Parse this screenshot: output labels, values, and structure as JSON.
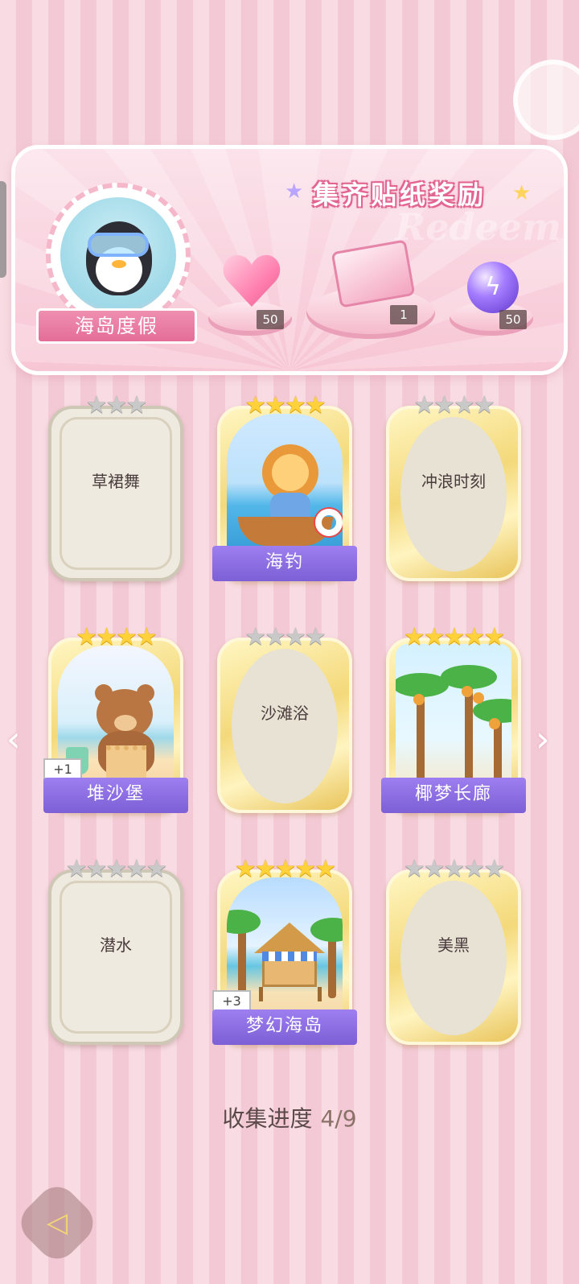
{
  "banner": {
    "title": "集齐贴纸奖励",
    "watermark": "Redeem",
    "album_name": "海岛度假",
    "rewards": [
      {
        "icon": "heart-gem-icon",
        "count": "50"
      },
      {
        "icon": "gift-box-icon",
        "count": "1"
      },
      {
        "icon": "lightning-orb-icon",
        "count": "50"
      }
    ]
  },
  "cards": [
    {
      "name": "草裙舞",
      "stars": 3,
      "star_color": "silver",
      "frame": "silver",
      "collected": false
    },
    {
      "name": "海钓",
      "stars": 4,
      "star_color": "gold",
      "frame": "gold",
      "collected": true,
      "art": "lion-fishing"
    },
    {
      "name": "冲浪时刻",
      "stars": 4,
      "star_color": "silver",
      "frame": "gold",
      "collected": false
    },
    {
      "name": "堆沙堡",
      "stars": 4,
      "star_color": "gold",
      "frame": "gold",
      "collected": true,
      "art": "bear-sandcastle",
      "extra": "+1"
    },
    {
      "name": "沙滩浴",
      "stars": 4,
      "star_color": "silver",
      "frame": "gold",
      "collected": false
    },
    {
      "name": "椰梦长廊",
      "stars": 5,
      "star_color": "gold",
      "frame": "gold",
      "collected": true,
      "art": "palm-grove"
    },
    {
      "name": "潜水",
      "stars": 5,
      "star_color": "silver",
      "frame": "silver",
      "collected": false
    },
    {
      "name": "梦幻海岛",
      "stars": 5,
      "star_color": "gold",
      "frame": "gold",
      "collected": true,
      "art": "beach-hut",
      "extra": "+3"
    },
    {
      "name": "美黑",
      "stars": 5,
      "star_color": "silver",
      "frame": "gold",
      "collected": false
    }
  ],
  "progress": {
    "label": "收集进度",
    "value": "4/9"
  },
  "nav": {
    "prev_icon": "chevron-left-icon",
    "next_icon": "chevron-right-icon",
    "back_icon": "back-arrow-icon"
  },
  "colors": {
    "accent_pink": "#e46d98",
    "ribbon_purple": "#7d5fd6",
    "gold_star": "#ffd23c",
    "silver_star": "#c9c9c9"
  }
}
